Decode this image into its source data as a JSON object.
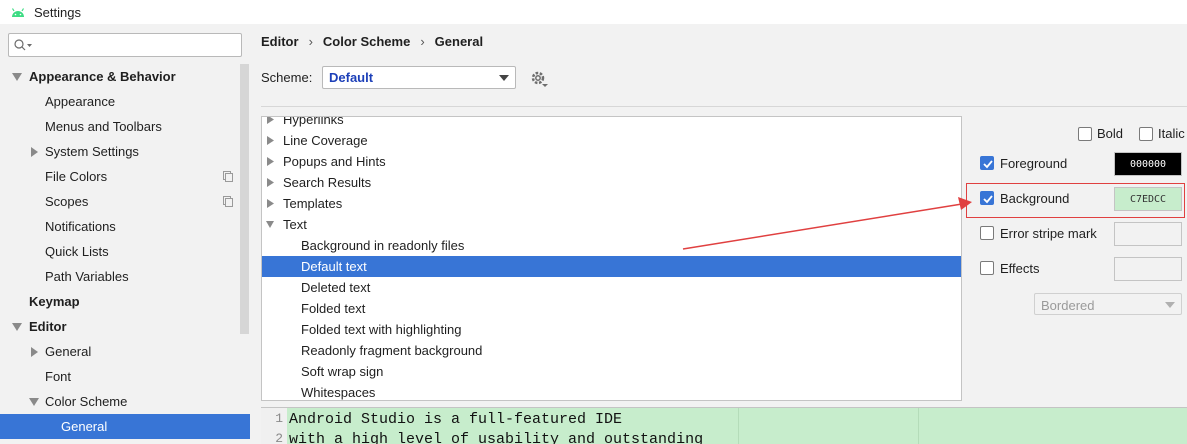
{
  "window": {
    "title": "Settings"
  },
  "sidebar": {
    "items": [
      {
        "label": "Appearance & Behavior",
        "bold": true,
        "arrow": "down",
        "indent": 0
      },
      {
        "label": "Appearance",
        "indent": 1
      },
      {
        "label": "Menus and Toolbars",
        "indent": 1
      },
      {
        "label": "System Settings",
        "indent": 1,
        "arrow": "right"
      },
      {
        "label": "File Colors",
        "indent": 1,
        "copy": true
      },
      {
        "label": "Scopes",
        "indent": 1,
        "copy": true
      },
      {
        "label": "Notifications",
        "indent": 1
      },
      {
        "label": "Quick Lists",
        "indent": 1
      },
      {
        "label": "Path Variables",
        "indent": 1
      },
      {
        "label": "Keymap",
        "bold": true,
        "indent": 0
      },
      {
        "label": "Editor",
        "bold": true,
        "arrow": "down",
        "indent": 0
      },
      {
        "label": "General",
        "indent": 1,
        "arrow": "right"
      },
      {
        "label": "Font",
        "indent": 1
      },
      {
        "label": "Color Scheme",
        "indent": 1,
        "arrow": "down"
      },
      {
        "label": "General",
        "indent": 2,
        "selected": true
      }
    ]
  },
  "breadcrumb": [
    "Editor",
    "Color Scheme",
    "General"
  ],
  "breadcrumb_sep": "›",
  "scheme": {
    "label": "Scheme:",
    "value": "Default"
  },
  "elements": [
    {
      "label": "Hyperlinks",
      "arrow": "right",
      "indent": 0
    },
    {
      "label": "Line Coverage",
      "arrow": "right",
      "indent": 0
    },
    {
      "label": "Popups and Hints",
      "arrow": "right",
      "indent": 0
    },
    {
      "label": "Search Results",
      "arrow": "right",
      "indent": 0
    },
    {
      "label": "Templates",
      "arrow": "right",
      "indent": 0
    },
    {
      "label": "Text",
      "arrow": "down",
      "indent": 0
    },
    {
      "label": "Background in readonly files",
      "indent": 1
    },
    {
      "label": "Default text",
      "indent": 1,
      "selected": true
    },
    {
      "label": "Deleted text",
      "indent": 1
    },
    {
      "label": "Folded text",
      "indent": 1
    },
    {
      "label": "Folded text with highlighting",
      "indent": 1
    },
    {
      "label": "Readonly fragment background",
      "indent": 1
    },
    {
      "label": "Soft wrap sign",
      "indent": 1
    },
    {
      "label": "Whitespaces",
      "indent": 1
    }
  ],
  "attributes": {
    "bold": {
      "label": "Bold",
      "checked": false
    },
    "italic": {
      "label": "Italic",
      "checked": false
    },
    "foreground": {
      "label": "Foreground",
      "checked": true,
      "value": "000000",
      "color": "#000000",
      "text_color": "#ffffff"
    },
    "background": {
      "label": "Background",
      "checked": true,
      "value": "C7EDCC",
      "color": "#C7EDCC",
      "text_color": "#333333"
    },
    "error_stripe": {
      "label": "Error stripe mark",
      "checked": false,
      "value": ""
    },
    "effects": {
      "label": "Effects",
      "checked": false,
      "value": "",
      "style": "Bordered"
    }
  },
  "preview": {
    "lines": [
      {
        "num": "1",
        "text": "Android Studio is a full-featured IDE"
      },
      {
        "num": "2",
        "text": "with a high level of usability and outstanding"
      }
    ],
    "background": "#C7EDCC"
  },
  "colors": {
    "accent": "#3875d6",
    "annotation": "#e04040"
  }
}
